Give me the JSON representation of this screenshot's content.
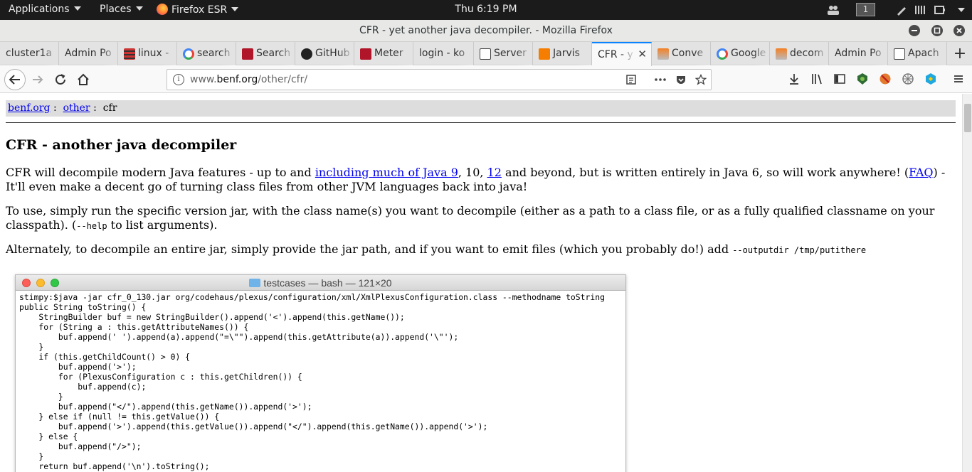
{
  "topbar": {
    "applications": "Applications",
    "places": "Places",
    "firefox": "Firefox ESR",
    "clock": "Thu  6:19 PM",
    "workspace": "1"
  },
  "window": {
    "title": "CFR - yet another java decompiler. - Mozilla Firefox"
  },
  "tabs": [
    {
      "label": "cluster1a",
      "favicon": "none"
    },
    {
      "label": "Admin Po",
      "favicon": "none"
    },
    {
      "label": "linux -",
      "favicon": "stackexchange-icon"
    },
    {
      "label": "search",
      "favicon": "google-icon"
    },
    {
      "label": "Search",
      "favicon": "apache-icon"
    },
    {
      "label": "GitHub",
      "favicon": "github-icon"
    },
    {
      "label": "Meter",
      "favicon": "apache-icon"
    },
    {
      "label": "login - ko",
      "favicon": "none"
    },
    {
      "label": "Server",
      "favicon": "image-icon"
    },
    {
      "label": "Jarvis",
      "favicon": "blogger-icon"
    },
    {
      "label": "CFR - y",
      "favicon": "none",
      "active": true
    },
    {
      "label": "Conve",
      "favicon": "stackoverflow-icon"
    },
    {
      "label": "Google",
      "favicon": "google-icon"
    },
    {
      "label": "decom",
      "favicon": "stackoverflow-icon"
    },
    {
      "label": "Admin Po",
      "favicon": "none"
    },
    {
      "label": "Apach",
      "favicon": "image-icon"
    }
  ],
  "urlbar": {
    "prefix": "www.",
    "host": "benf.org",
    "path": "/other/cfr/"
  },
  "breadcrumb": {
    "root": "benf.org",
    "sep1": ":",
    "other": "other",
    "sep2": ":",
    "current": "cfr"
  },
  "page": {
    "title": "CFR - another java decompiler",
    "p1": {
      "t1": "CFR will decompile modern Java features - up to and ",
      "link1": "including much of Java 9",
      "t2": ", 10, ",
      "link2": "12",
      "t3": " and beyond, but is written entirely in Java 6, so will work anywhere! (",
      "link3": "FAQ",
      "t4": ") - It'll even make a decent go of turning class files from other JVM languages back into java!"
    },
    "p2": {
      "t1": "To use, simply run the specific version jar, with the class name(s) you want to decompile (either as a path to a class file, or as a fully qualified classname on your classpath). (",
      "code": "--help",
      "t2": " to list arguments)."
    },
    "p3": {
      "t1": "Alternately, to decompile an entire jar, simply provide the jar path, and if you want to emit files (which you probably do!) add ",
      "code": "--outputdir /tmp/putithere"
    }
  },
  "terminal": {
    "title": "testcases — bash — 121×20",
    "lines": [
      "stimpy:$java -jar cfr_0_130.jar org/codehaus/plexus/configuration/xml/XmlPlexusConfiguration.class --methodname toString",
      "public String toString() {",
      "    StringBuilder buf = new StringBuilder().append('<').append(this.getName());",
      "    for (String a : this.getAttributeNames()) {",
      "        buf.append(' ').append(a).append(\"=\\\"\").append(this.getAttribute(a)).append('\\\"');",
      "    }",
      "    if (this.getChildCount() > 0) {",
      "        buf.append('>');",
      "        for (PlexusConfiguration c : this.getChildren()) {",
      "            buf.append(c);",
      "        }",
      "        buf.append(\"</\").append(this.getName()).append('>');",
      "    } else if (null != this.getValue()) {",
      "        buf.append('>').append(this.getValue()).append(\"</\").append(this.getName()).append('>');",
      "    } else {",
      "        buf.append(\"/>\");",
      "    }",
      "    return buf.append('\\n').toString();"
    ]
  },
  "colors": {
    "accent": "#0a84ff",
    "link": "#0000ee",
    "topbar": "#1b1b1b"
  }
}
